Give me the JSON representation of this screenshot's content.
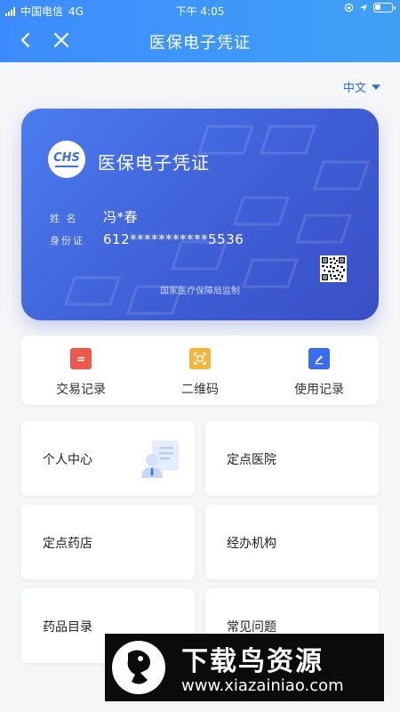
{
  "status_bar": {
    "carrier": "中国电信",
    "network": "4G",
    "time": "下午 4:05"
  },
  "header": {
    "title": "医保电子凭证",
    "back_icon": "chevron-left-icon",
    "close_icon": "close-icon",
    "background_color": "#3d8cff"
  },
  "language": {
    "selected": "中文"
  },
  "card": {
    "logo_text": "CHS",
    "title": "医保电子凭证",
    "name_label": "姓 名",
    "name_value": "冯*春",
    "id_label": "身份证",
    "id_value": "612***********5536",
    "footer": "国家医疗保障局监制",
    "color": "#4166dd"
  },
  "actions": [
    {
      "label": "交易记录",
      "icon": "document-icon",
      "color": "#f0564a"
    },
    {
      "label": "二维码",
      "icon": "scan-frame-icon",
      "color": "#f5b53a"
    },
    {
      "label": "使用记录",
      "icon": "edit-icon",
      "color": "#3a6cf0"
    }
  ],
  "tiles": [
    {
      "label": "个人中心",
      "icon": "person-card-icon"
    },
    {
      "label": "定点医院"
    },
    {
      "label": "定点药店"
    },
    {
      "label": "经办机构"
    },
    {
      "label": "药品目录"
    },
    {
      "label": "常见问题"
    }
  ],
  "watermark": {
    "title": "下载鸟资源",
    "url": "www.xiazainiao.com"
  }
}
